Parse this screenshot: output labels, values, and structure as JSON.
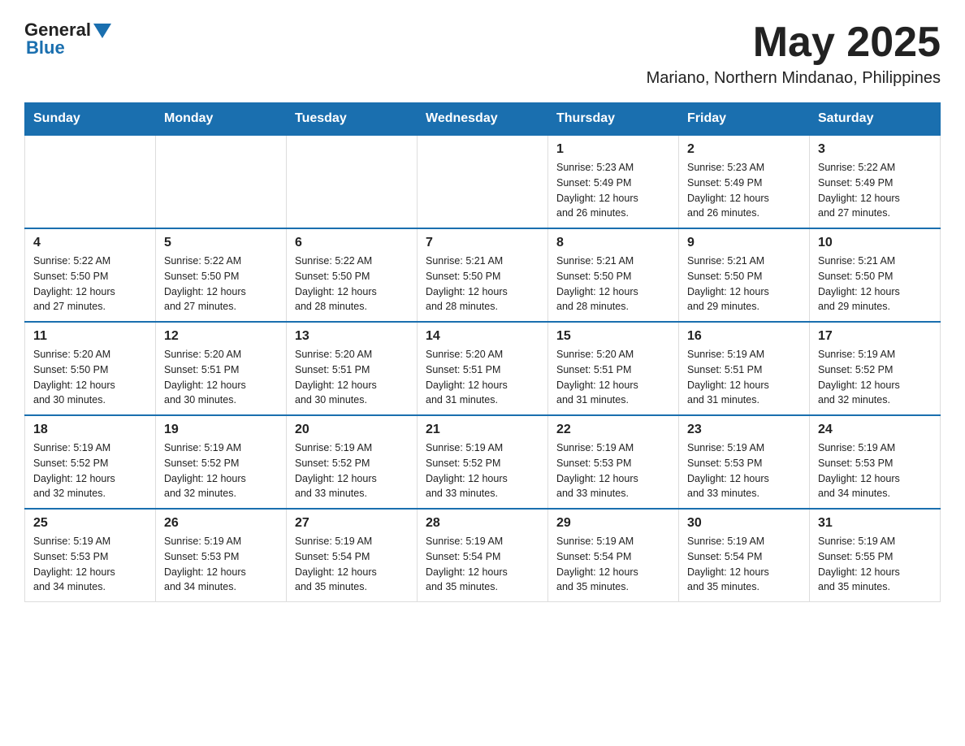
{
  "header": {
    "logo_general": "General",
    "logo_blue": "Blue",
    "month_title": "May 2025",
    "location": "Mariano, Northern Mindanao, Philippines"
  },
  "days_of_week": [
    "Sunday",
    "Monday",
    "Tuesday",
    "Wednesday",
    "Thursday",
    "Friday",
    "Saturday"
  ],
  "weeks": [
    [
      {
        "day": "",
        "info": ""
      },
      {
        "day": "",
        "info": ""
      },
      {
        "day": "",
        "info": ""
      },
      {
        "day": "",
        "info": ""
      },
      {
        "day": "1",
        "info": "Sunrise: 5:23 AM\nSunset: 5:49 PM\nDaylight: 12 hours\nand 26 minutes."
      },
      {
        "day": "2",
        "info": "Sunrise: 5:23 AM\nSunset: 5:49 PM\nDaylight: 12 hours\nand 26 minutes."
      },
      {
        "day": "3",
        "info": "Sunrise: 5:22 AM\nSunset: 5:49 PM\nDaylight: 12 hours\nand 27 minutes."
      }
    ],
    [
      {
        "day": "4",
        "info": "Sunrise: 5:22 AM\nSunset: 5:50 PM\nDaylight: 12 hours\nand 27 minutes."
      },
      {
        "day": "5",
        "info": "Sunrise: 5:22 AM\nSunset: 5:50 PM\nDaylight: 12 hours\nand 27 minutes."
      },
      {
        "day": "6",
        "info": "Sunrise: 5:22 AM\nSunset: 5:50 PM\nDaylight: 12 hours\nand 28 minutes."
      },
      {
        "day": "7",
        "info": "Sunrise: 5:21 AM\nSunset: 5:50 PM\nDaylight: 12 hours\nand 28 minutes."
      },
      {
        "day": "8",
        "info": "Sunrise: 5:21 AM\nSunset: 5:50 PM\nDaylight: 12 hours\nand 28 minutes."
      },
      {
        "day": "9",
        "info": "Sunrise: 5:21 AM\nSunset: 5:50 PM\nDaylight: 12 hours\nand 29 minutes."
      },
      {
        "day": "10",
        "info": "Sunrise: 5:21 AM\nSunset: 5:50 PM\nDaylight: 12 hours\nand 29 minutes."
      }
    ],
    [
      {
        "day": "11",
        "info": "Sunrise: 5:20 AM\nSunset: 5:50 PM\nDaylight: 12 hours\nand 30 minutes."
      },
      {
        "day": "12",
        "info": "Sunrise: 5:20 AM\nSunset: 5:51 PM\nDaylight: 12 hours\nand 30 minutes."
      },
      {
        "day": "13",
        "info": "Sunrise: 5:20 AM\nSunset: 5:51 PM\nDaylight: 12 hours\nand 30 minutes."
      },
      {
        "day": "14",
        "info": "Sunrise: 5:20 AM\nSunset: 5:51 PM\nDaylight: 12 hours\nand 31 minutes."
      },
      {
        "day": "15",
        "info": "Sunrise: 5:20 AM\nSunset: 5:51 PM\nDaylight: 12 hours\nand 31 minutes."
      },
      {
        "day": "16",
        "info": "Sunrise: 5:19 AM\nSunset: 5:51 PM\nDaylight: 12 hours\nand 31 minutes."
      },
      {
        "day": "17",
        "info": "Sunrise: 5:19 AM\nSunset: 5:52 PM\nDaylight: 12 hours\nand 32 minutes."
      }
    ],
    [
      {
        "day": "18",
        "info": "Sunrise: 5:19 AM\nSunset: 5:52 PM\nDaylight: 12 hours\nand 32 minutes."
      },
      {
        "day": "19",
        "info": "Sunrise: 5:19 AM\nSunset: 5:52 PM\nDaylight: 12 hours\nand 32 minutes."
      },
      {
        "day": "20",
        "info": "Sunrise: 5:19 AM\nSunset: 5:52 PM\nDaylight: 12 hours\nand 33 minutes."
      },
      {
        "day": "21",
        "info": "Sunrise: 5:19 AM\nSunset: 5:52 PM\nDaylight: 12 hours\nand 33 minutes."
      },
      {
        "day": "22",
        "info": "Sunrise: 5:19 AM\nSunset: 5:53 PM\nDaylight: 12 hours\nand 33 minutes."
      },
      {
        "day": "23",
        "info": "Sunrise: 5:19 AM\nSunset: 5:53 PM\nDaylight: 12 hours\nand 33 minutes."
      },
      {
        "day": "24",
        "info": "Sunrise: 5:19 AM\nSunset: 5:53 PM\nDaylight: 12 hours\nand 34 minutes."
      }
    ],
    [
      {
        "day": "25",
        "info": "Sunrise: 5:19 AM\nSunset: 5:53 PM\nDaylight: 12 hours\nand 34 minutes."
      },
      {
        "day": "26",
        "info": "Sunrise: 5:19 AM\nSunset: 5:53 PM\nDaylight: 12 hours\nand 34 minutes."
      },
      {
        "day": "27",
        "info": "Sunrise: 5:19 AM\nSunset: 5:54 PM\nDaylight: 12 hours\nand 35 minutes."
      },
      {
        "day": "28",
        "info": "Sunrise: 5:19 AM\nSunset: 5:54 PM\nDaylight: 12 hours\nand 35 minutes."
      },
      {
        "day": "29",
        "info": "Sunrise: 5:19 AM\nSunset: 5:54 PM\nDaylight: 12 hours\nand 35 minutes."
      },
      {
        "day": "30",
        "info": "Sunrise: 5:19 AM\nSunset: 5:54 PM\nDaylight: 12 hours\nand 35 minutes."
      },
      {
        "day": "31",
        "info": "Sunrise: 5:19 AM\nSunset: 5:55 PM\nDaylight: 12 hours\nand 35 minutes."
      }
    ]
  ]
}
